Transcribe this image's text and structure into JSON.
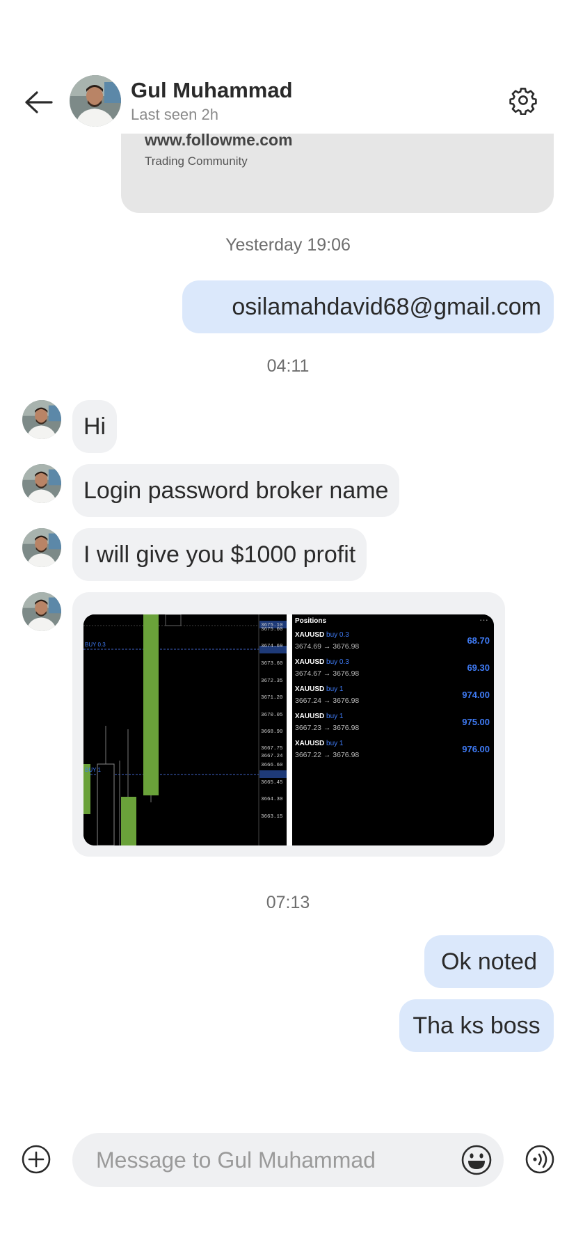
{
  "header": {
    "contact_name": "Gul Muhammad",
    "status": "Last seen 2h",
    "back_icon": "arrow-left-icon",
    "settings_icon": "gear-icon"
  },
  "link_preview": {
    "url": "www.followme.com",
    "description": "Trading Community"
  },
  "messages": [
    {
      "type": "timestamp",
      "text": "Yesterday 19:06"
    },
    {
      "type": "outgoing",
      "text": "osilamahdavid68@gmail.com"
    },
    {
      "type": "timestamp",
      "text": "04:11"
    },
    {
      "type": "incoming",
      "text": "Hi"
    },
    {
      "type": "incoming",
      "text": "Login password broker name"
    },
    {
      "type": "incoming",
      "text": "I will give you $1000 profit"
    },
    {
      "type": "incoming-image",
      "text": ""
    },
    {
      "type": "timestamp",
      "text": "07:13"
    },
    {
      "type": "outgoing",
      "text": "Ok noted"
    },
    {
      "type": "outgoing",
      "text": "Tha ks boss"
    }
  ],
  "screenshot_image": {
    "chart": {
      "price_labels": [
        "3675.10",
        "3675.00",
        "3674.69",
        "3673.60",
        "3672.35",
        "3671.20",
        "3670.05",
        "3668.90",
        "3667.75",
        "3667.24",
        "3666.60",
        "3665.45",
        "3664.30",
        "3663.15"
      ],
      "order_lines": [
        "BUY 0.3",
        "BUY 1"
      ]
    },
    "positions": {
      "title": "Positions",
      "menu": "···",
      "rows": [
        {
          "symbol": "XAUUSD",
          "side": "buy 0.3",
          "prices": "3674.69 → 3676.98",
          "profit": "68.70"
        },
        {
          "symbol": "XAUUSD",
          "side": "buy 0.3",
          "prices": "3674.67 → 3676.98",
          "profit": "69.30"
        },
        {
          "symbol": "XAUUSD",
          "side": "buy 1",
          "prices": "3667.24 → 3676.98",
          "profit": "974.00"
        },
        {
          "symbol": "XAUUSD",
          "side": "buy 1",
          "prices": "3667.23 → 3676.98",
          "profit": "975.00"
        },
        {
          "symbol": "XAUUSD",
          "side": "buy 1",
          "prices": "3667.22 → 3676.98",
          "profit": "976.00"
        }
      ]
    }
  },
  "composer": {
    "placeholder": "Message to Gul Muhammad",
    "plus_icon": "plus-circle-icon",
    "emoji_icon": "emoji-icon",
    "voice_icon": "voice-message-icon"
  },
  "colors": {
    "outgoing_bubble": "#dbe8fb",
    "incoming_bubble": "#f0f1f3",
    "candle_green": "#6aa23a",
    "position_blue": "#3f7bf5"
  }
}
